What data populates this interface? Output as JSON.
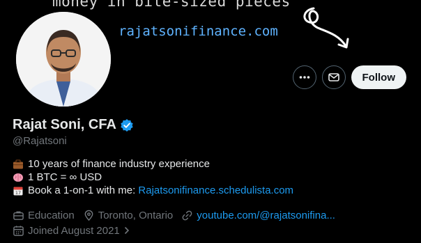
{
  "banner": {
    "tagline": "money in bite-sized pieces",
    "url": "rajatsonifinance.com"
  },
  "actions": {
    "more_icon": "more-icon",
    "message_icon": "mail-icon",
    "follow_label": "Follow"
  },
  "profile": {
    "name": "Rajat Soni, CFA",
    "handle": "@Rajatsoni",
    "verified_icon": "verified-badge-icon",
    "verified_color": "#1d9bf0"
  },
  "bio": {
    "line1": "10 years of finance industry experience",
    "line2": "1 BTC = ∞ USD",
    "line3_prefix": "Book a 1-on-1 with me: ",
    "line3_link": "Rajatsonifinance.schedulista.com"
  },
  "meta": {
    "category": "Education",
    "location": "Toronto, Ontario",
    "website": "youtube.com/@rajatsonifina...",
    "joined": "Joined August 2021"
  },
  "colors": {
    "link": "#1d9bf0",
    "muted": "#71767b",
    "text": "#e7e9ea"
  }
}
